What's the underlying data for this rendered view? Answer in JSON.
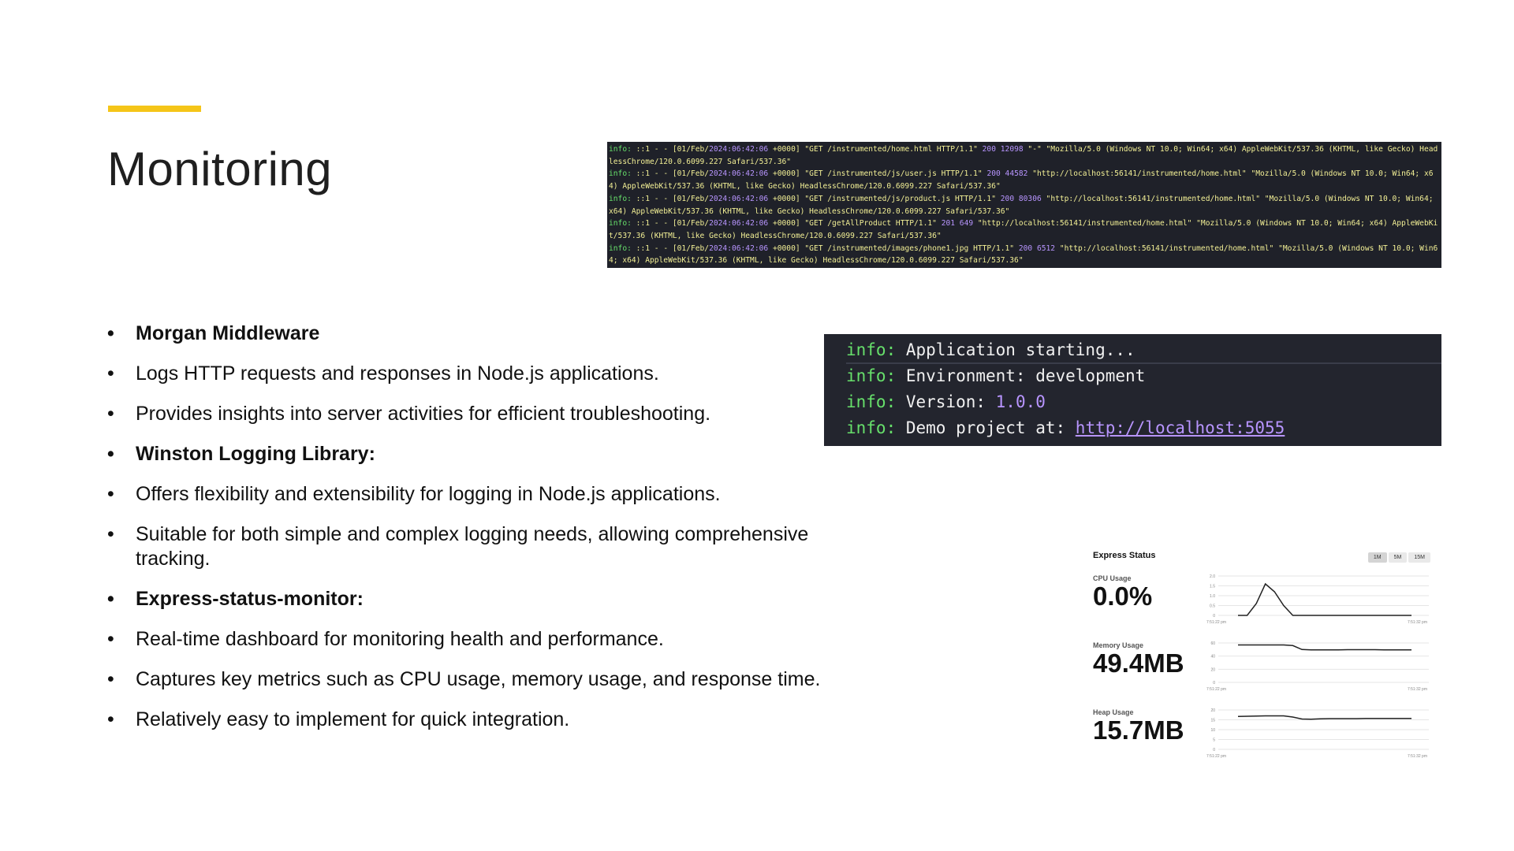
{
  "slide": {
    "title": "Monitoring"
  },
  "bullets": [
    {
      "text": "Morgan Middleware",
      "bold": true
    },
    {
      "text": "Logs HTTP requests and responses in Node.js applications.",
      "bold": false
    },
    {
      "text": "Provides insights into server activities for efficient troubleshooting.",
      "bold": false
    },
    {
      "text": "Winston Logging Library:",
      "bold": true
    },
    {
      "text": "Offers flexibility and extensibility for logging in Node.js applications.",
      "bold": false
    },
    {
      "text": "Suitable for both simple and complex logging needs, allowing comprehensive tracking.",
      "bold": false
    },
    {
      "text": "Express-status-monitor:",
      "bold": true
    },
    {
      "text": "Real-time dashboard for monitoring health and performance.",
      "bold": false
    },
    {
      "text": "Captures key metrics such as CPU usage, memory usage, and response time.",
      "bold": false
    },
    {
      "text": "Relatively easy to implement for quick integration.",
      "bold": false
    }
  ],
  "bullet_char": "•",
  "colors": {
    "accent": "#f5c518",
    "terminal_bg": "#1f2129",
    "log_green": "#67e06b",
    "log_purple": "#b895ff",
    "log_yellow": "#f2ef95"
  },
  "morgan_log": {
    "level": "info:",
    "entries": [
      {
        "prefix": " ::1 - - [01/Feb/",
        "date": "2024:06:42:06",
        "mid": " +0000] \"GET /instrumented/home.html HTTP/1.1\" ",
        "status": "200",
        "size": "12098",
        "rest": " \"-\" \"Mozilla/5.0 (Windows NT 10.0; Win64; x64) AppleWebKit/537.36 (KHTML, like Gecko) HeadlessChrome/120.0.6099.227 Safari/537.36\""
      },
      {
        "prefix": " ::1 - - [01/Feb/",
        "date": "2024:06:42:06",
        "mid": " +0000] \"GET /instrumented/js/user.js HTTP/1.1\" ",
        "status": "200",
        "size": "44582",
        "rest": " \"http://localhost:56141/instrumented/home.html\" \"Mozilla/5.0 (Windows NT 10.0; Win64; x64) AppleWebKit/537.36 (KHTML, like Gecko) HeadlessChrome/120.0.6099.227 Safari/537.36\""
      },
      {
        "prefix": " ::1 - - [01/Feb/",
        "date": "2024:06:42:06",
        "mid": " +0000] \"GET /instrumented/js/product.js HTTP/1.1\" ",
        "status": "200",
        "size": "80306",
        "rest": " \"http://localhost:56141/instrumented/home.html\" \"Mozilla/5.0 (Windows NT 10.0; Win64; x64) AppleWebKit/537.36 (KHTML, like Gecko) HeadlessChrome/120.0.6099.227 Safari/537.36\""
      },
      {
        "prefix": " ::1 - - [01/Feb/",
        "date": "2024:06:42:06",
        "mid": " +0000] \"GET /getAllProduct HTTP/1.1\" ",
        "status": "201",
        "size": "649",
        "rest": " \"http://localhost:56141/instrumented/home.html\" \"Mozilla/5.0 (Windows NT 10.0; Win64; x64) AppleWebKit/537.36 (KHTML, like Gecko) HeadlessChrome/120.0.6099.227 Safari/537.36\""
      },
      {
        "prefix": " ::1 - - [01/Feb/",
        "date": "2024:06:42:06",
        "mid": " +0000] \"GET /instrumented/images/phone1.jpg HTTP/1.1\" ",
        "status": "200",
        "size": "6512",
        "rest": " \"http://localhost:56141/instrumented/home.html\" \"Mozilla/5.0 (Windows NT 10.0; Win64; x64) AppleWebKit/537.36 (KHTML, like Gecko) HeadlessChrome/120.0.6099.227 Safari/537.36\""
      }
    ]
  },
  "winston_log": {
    "level": "info:",
    "lines": [
      {
        "text": "Application starting...",
        "highlight": ""
      },
      {
        "text": "Environment: development",
        "highlight": ""
      },
      {
        "text": "Version: ",
        "highlight": "1.0.0"
      },
      {
        "text": "Demo project at: ",
        "highlight": "http://localhost:5055"
      }
    ]
  },
  "express_status": {
    "title": "Express Status",
    "tabs": [
      "1M",
      "5M",
      "15M"
    ],
    "active_tab": "1M",
    "metrics": [
      {
        "label": "CPU Usage",
        "value": "0.0%"
      },
      {
        "label": "Memory Usage",
        "value": "49.4MB"
      },
      {
        "label": "Heap Usage",
        "value": "15.7MB"
      }
    ]
  },
  "chart_data": [
    {
      "type": "line",
      "name": "cpu",
      "yticks": [
        "2.0",
        "1.5",
        "1.0",
        "0.5",
        "0"
      ],
      "ylim": [
        0,
        2
      ],
      "xticks": [
        "7:51:22 pm",
        "7:51:32 pm"
      ],
      "values": [
        0,
        0,
        0.6,
        1.6,
        1.2,
        0.5,
        0,
        0,
        0,
        0,
        0,
        0,
        0,
        0,
        0,
        0,
        0,
        0,
        0,
        0
      ]
    },
    {
      "type": "line",
      "name": "memory",
      "yticks": [
        "60",
        "40",
        "20",
        "0"
      ],
      "ylim": [
        0,
        60
      ],
      "xticks": [
        "7:51:22 pm",
        "7:51:32 pm"
      ],
      "values": [
        57,
        57,
        57,
        57,
        57,
        57,
        56,
        50,
        49.5,
        49.5,
        49.5,
        49.6,
        49.8,
        49.8,
        49.8,
        49.8,
        49.6,
        49.6,
        49.4,
        49.4
      ]
    },
    {
      "type": "line",
      "name": "heap",
      "yticks": [
        "20",
        "15",
        "10",
        "5",
        "0"
      ],
      "ylim": [
        0,
        20
      ],
      "xticks": [
        "7:51:22 pm",
        "7:51:32 pm"
      ],
      "values": [
        16.7,
        16.8,
        16.9,
        17.0,
        17.0,
        17.0,
        16.4,
        15.4,
        15.3,
        15.5,
        15.6,
        15.6,
        15.6,
        15.6,
        15.7,
        15.7,
        15.7,
        15.7,
        15.7,
        15.7
      ]
    }
  ]
}
